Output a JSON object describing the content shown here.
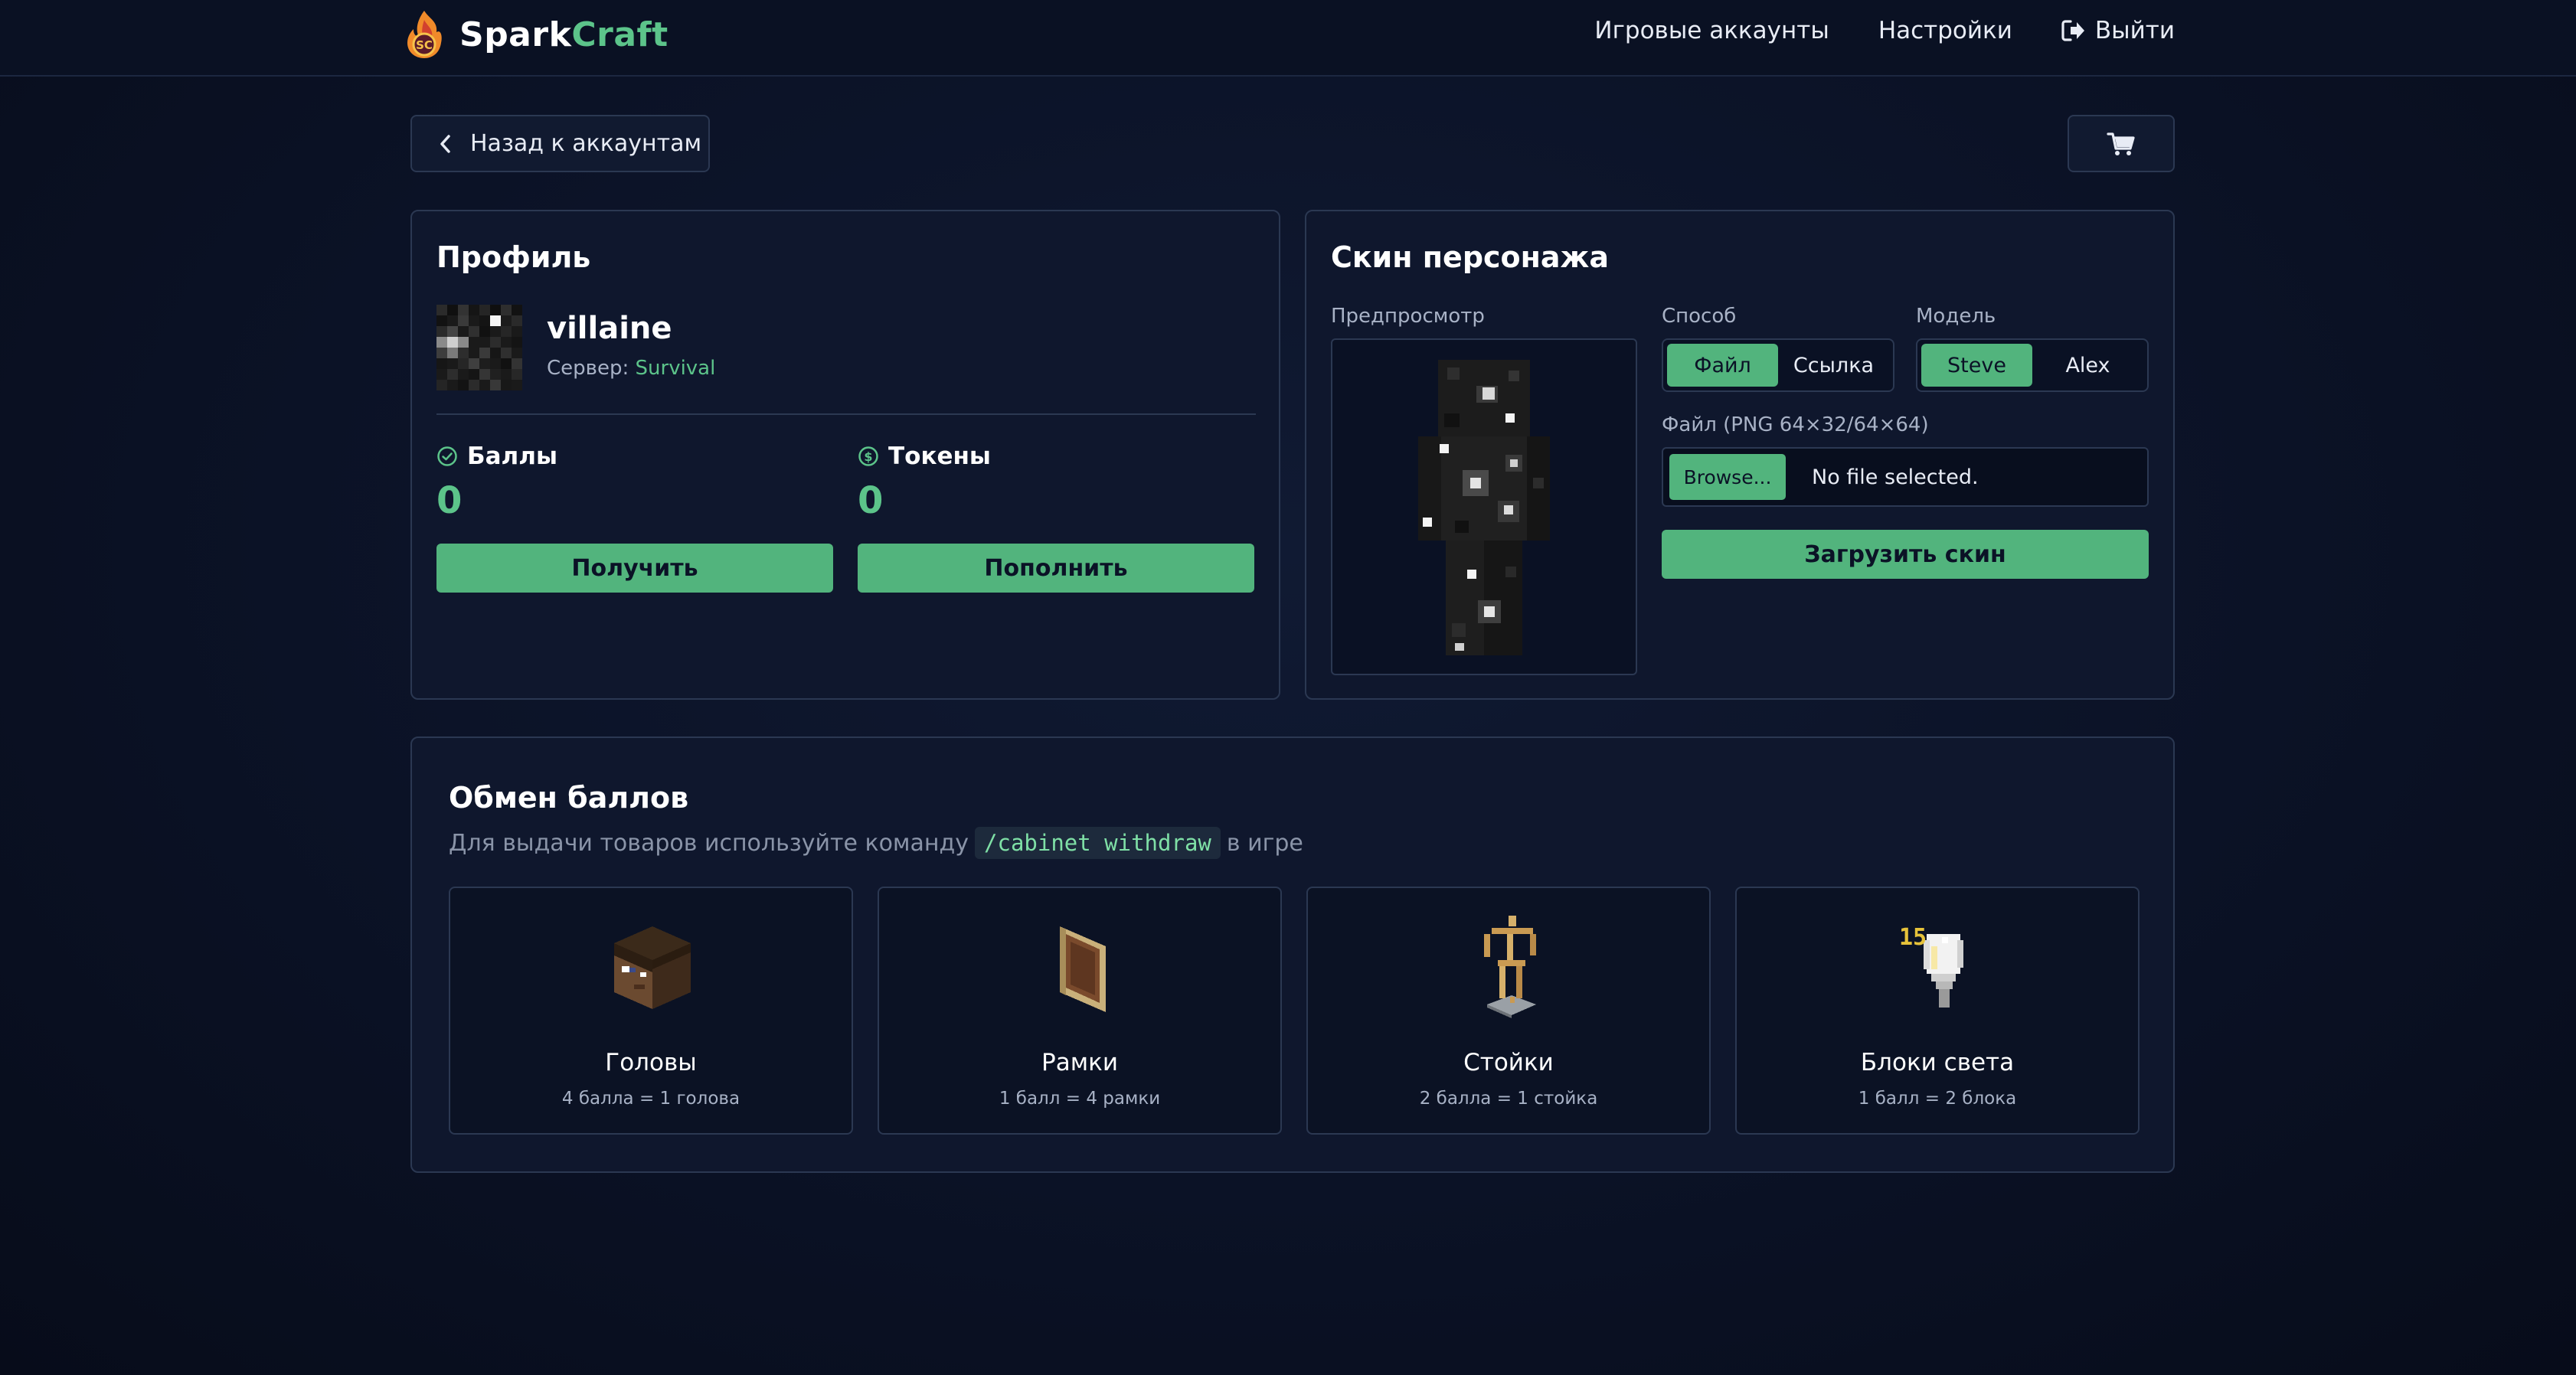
{
  "header": {
    "logo_part1": "Spark",
    "logo_part2": "Craft",
    "nav": [
      "Игровые аккаунты",
      "Настройки",
      "Выйти"
    ]
  },
  "back_label": "Назад к аккаунтам",
  "profile": {
    "title": "Профиль",
    "name": "villaine",
    "server_label": "Сервер:",
    "server_value": "Survival",
    "points_label": "Баллы",
    "points_value": "0",
    "tokens_label": "Токены",
    "tokens_value": "0",
    "get_label": "Получить",
    "topup_label": "Пополнить"
  },
  "skin": {
    "title": "Скин персонажа",
    "preview_label": "Предпросмотр",
    "method_label": "Способ",
    "method_options": [
      "Файл",
      "Ссылка"
    ],
    "method_selected": "Файл",
    "model_label": "Модель",
    "model_options": [
      "Steve",
      "Alex"
    ],
    "model_selected": "Steve",
    "file_label": "Файл (PNG 64×32/64×64)",
    "browse_label": "Browse...",
    "file_status": "No file selected.",
    "upload_label": "Загрузить скин"
  },
  "exchange": {
    "title": "Обмен баллов",
    "subtitle_before": "Для выдачи товаров используйте команду",
    "command": "/cabinet withdraw",
    "subtitle_after": "в игре",
    "items": [
      {
        "name": "Головы",
        "price": "4 балла = 1 голова",
        "icon": "player-head-icon"
      },
      {
        "name": "Рамки",
        "price": "1 балл = 4 рамки",
        "icon": "item-frame-icon"
      },
      {
        "name": "Стойки",
        "price": "2 балла = 1 стойка",
        "icon": "armor-stand-icon"
      },
      {
        "name": "Блоки света",
        "price": "1 балл = 2 блока",
        "icon": "light-block-icon"
      }
    ]
  },
  "colors": {
    "accent": "#52b47d",
    "accent_text": "#5cc48a",
    "background": "#0b1226",
    "border": "#2b3852"
  }
}
